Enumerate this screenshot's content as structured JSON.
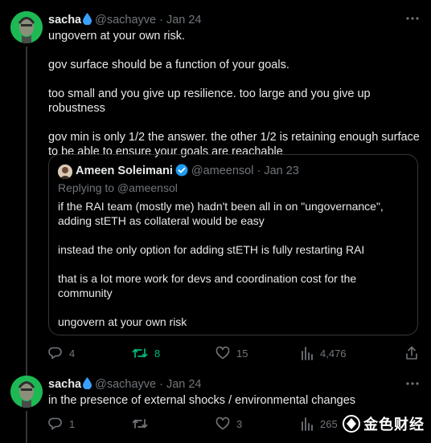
{
  "tweet1": {
    "display_name": "sacha",
    "handle": "@sachayve",
    "dot": "·",
    "date": "Jan 24",
    "paragraphs": [
      "ungovern at your own risk.",
      "gov surface should be a function of your goals.",
      "too small and you give up resilience. too large and you give up robustness",
      "gov min is only 1/2 the answer. the other 1/2 is retaining enough surface to be able to ensure your goals are reachable"
    ],
    "quote": {
      "display_name": "Ameen Soleimani",
      "handle": "@ameensol",
      "dot": "·",
      "date": "Jan 23",
      "replying_to": "Replying to @ameensol",
      "paragraphs": [
        "if the RAI team (mostly me) hadn't been all in on \"ungovernance\", adding stETH as collateral would be easy",
        "instead the only option for adding stETH is fully restarting RAI",
        "that is a lot more work for devs and coordination cost for the community",
        "ungovern at your own risk"
      ]
    },
    "actions": {
      "replies": "4",
      "retweets": "8",
      "likes": "15",
      "views": "4,476"
    }
  },
  "tweet2": {
    "display_name": "sacha",
    "handle": "@sachayve",
    "dot": "·",
    "date": "Jan 24",
    "text": "in the presence of external shocks / environmental changes",
    "actions": {
      "replies": "1",
      "retweets": "",
      "likes": "3",
      "views": "265"
    }
  },
  "watermark": "金色财经",
  "colors": {
    "background": "#000000",
    "text": "#e7e9ea",
    "muted": "#71767b",
    "retweet_active": "#00ba7c",
    "verified": "#1d9bf0",
    "avatar_bg": "#1db954"
  }
}
